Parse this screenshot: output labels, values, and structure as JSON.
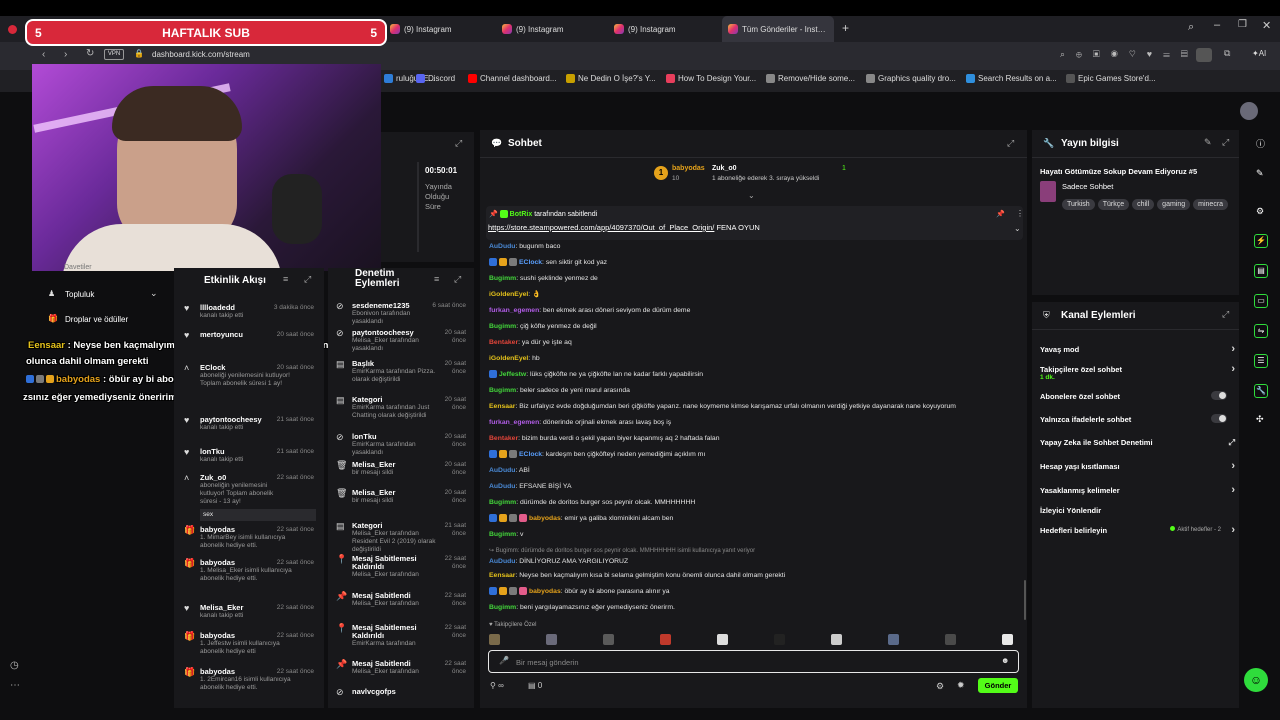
{
  "browser": {
    "tabs": [
      {
        "label": "(9) Instagram",
        "active": false
      },
      {
        "label": "(9) Instagram",
        "active": false
      },
      {
        "label": "(9) Instagram",
        "active": false
      },
      {
        "label": "Tüm Gönderiler - Instagra",
        "active": true
      }
    ],
    "url": "dashboard.kick.com/stream",
    "vpn": "VPN",
    "ai": "AI",
    "bookmarks": [
      {
        "label": "ruluğu (E...",
        "color": "#2e7dd7"
      },
      {
        "label": "Discord",
        "color": "#5865f2"
      },
      {
        "label": "Channel dashboard...",
        "color": "#ff0000"
      },
      {
        "label": "Ne Dedin O İşe?'s Y...",
        "color": "#c8a000"
      },
      {
        "label": "How To Design Your...",
        "color": "#e83e5c"
      },
      {
        "label": "Remove/Hide some...",
        "color": "#888888"
      },
      {
        "label": "Graphics quality dro...",
        "color": "#888888"
      },
      {
        "label": "Search Results on a...",
        "color": "#2f8fdd"
      },
      {
        "label": "Epic Games Store'd...",
        "color": "#555555"
      }
    ]
  },
  "sub_banner": {
    "left_num": "5",
    "title": "HAFTALIK SUB",
    "right_num": "5"
  },
  "overlay_chat": [
    {
      "user": "Eensaar",
      "text": " : Neyse ben kaçmalıyım kısa bi selama gelmiştim konu önemli"
    },
    {
      "user": "",
      "text": "olunca dahil olmam gerekti"
    },
    {
      "user": "babyodas",
      "text": " : öbür ay bi abone parasına alınır ya"
    },
    {
      "user": "",
      "text": "zsınız eğer yemediyseniz öneririm."
    }
  ],
  "stream_stats": {
    "time": "00:50:01",
    "label": "Yayında Olduğu Süre"
  },
  "left_nav": {
    "partial": "Davetiler",
    "items": [
      {
        "label": "Topluluk",
        "expandable": true
      },
      {
        "label": "Droplar ve ödüller",
        "expandable": false
      }
    ]
  },
  "activity_feed": {
    "title": "Etkinlik Akışı",
    "items": [
      {
        "name": "lllloadedd",
        "sub": "kanalı takip etti",
        "time": "3 dakika önce",
        "icon": "heart"
      },
      {
        "name": "mertoyuncu",
        "sub": "",
        "time": "20 saat önce",
        "icon": "heart"
      },
      {
        "name": "EClock",
        "sub": "aboneliği yenilemesini kutluyor! Toplam abonelik süresi 1 ay!",
        "time": "20 saat önce",
        "icon": "caret"
      },
      {
        "name": "paytontoocheesy",
        "sub": "kanalı takip etti",
        "time": "21 saat önce",
        "icon": "heart"
      },
      {
        "name": "lonTku",
        "sub": "kanalı takip etti",
        "time": "21 saat önce",
        "icon": "heart"
      },
      {
        "name": "Zuk_o0",
        "sub": "aboneliğin yenilemesini kutluyor! Toplam abonelik süresi - 13 ay!",
        "time": "22 saat önce",
        "icon": "caret",
        "extra": "sex"
      },
      {
        "name": "babyodas",
        "sub": "1. MimarBey isimli kullanıcıya abonelik hediye etti.",
        "time": "22 saat önce",
        "icon": "gift"
      },
      {
        "name": "babyodas",
        "sub": "1. Melisa_Eker isimli kullanıcıya abonelik hediye etti.",
        "time": "22 saat önce",
        "icon": "gift"
      },
      {
        "name": "Melisa_Eker",
        "sub": "kanalı takip etti",
        "time": "22 saat önce",
        "icon": "heart"
      },
      {
        "name": "babyodas",
        "sub": "1. Jeffestw isimli kullanıcıya abonelik hediye etti",
        "time": "22 saat önce",
        "icon": "gift"
      },
      {
        "name": "babyodas",
        "sub": "1. 2Emircan16 isimli kullanıcıya abonelik hediye etti.",
        "time": "22 saat önce",
        "icon": "gift"
      }
    ]
  },
  "mod_actions": {
    "title": "Denetim Eylemleri",
    "items": [
      {
        "name": "sesdeneme1235",
        "sub": "Ebonivon tarafından yasaklandı",
        "time": "6 saat önce",
        "icon": "ban"
      },
      {
        "name": "paytontoocheesy",
        "sub": "Melisa_Eker tarafından yasaklandı",
        "time": "20 saat önce",
        "icon": "ban"
      },
      {
        "name": "Başlık",
        "sub": "EmirKarma tarafından Pizza. olarak değiştirildi",
        "time": "20 saat önce",
        "icon": "doc"
      },
      {
        "name": "Kategori",
        "sub": "EmirKarma tarafından Just Chatting olarak değiştirildi",
        "time": "20 saat önce",
        "icon": "doc"
      },
      {
        "name": "lonTku",
        "sub": "EmirKarma tarafından yasaklandı",
        "time": "20 saat önce",
        "icon": "ban"
      },
      {
        "name": "Melisa_Eker",
        "sub": "bir mesajı sildi",
        "time": "20 saat önce",
        "icon": "trash"
      },
      {
        "name": "Melisa_Eker",
        "sub": "bir mesajı sildi",
        "time": "20 saat önce",
        "icon": "trash"
      },
      {
        "name": "Kategori",
        "sub": "Melisa_Eker tarafından Resident Evil 2 (2019) olarak değiştirildi",
        "time": "21 saat önce",
        "icon": "doc"
      },
      {
        "name": "Mesaj Sabitlemesi Kaldırıldı",
        "sub": "Melisa_Eker tarafından",
        "time": "22 saat önce",
        "icon": "unpin"
      },
      {
        "name": "Mesaj Sabitlendi",
        "sub": "Melisa_Eker tarafından",
        "time": "22 saat önce",
        "icon": "pin"
      },
      {
        "name": "Mesaj Sabitlemesi Kaldırıldı",
        "sub": "EmirKarma tarafından",
        "time": "22 saat önce",
        "icon": "unpin"
      },
      {
        "name": "Mesaj Sabitlendi",
        "sub": "Melisa_Eker tarafından",
        "time": "22 saat önce",
        "icon": "pin"
      },
      {
        "name": "navlvcgofps",
        "sub": "",
        "time": "",
        "icon": "ban"
      }
    ]
  },
  "chat": {
    "title": "Sohbet",
    "top_gifters": [
      {
        "name": "babyodas",
        "count": "10"
      },
      {
        "name": "Zuk_o0",
        "count": "1 aboneliğe ederek 3. sıraya yükseldi"
      }
    ],
    "gifter_badge_count": "1",
    "pinned": {
      "by_user": "BotRix",
      "by_text": "tarafından sabitlendi",
      "link": "https://store.steampowered.com/app/4097370/Out_of_Place_Origin/",
      "suffix": " FENA OYUN"
    },
    "messages": [
      {
        "user": "AuDudu",
        "color": "#4a8ad6",
        "text": "bugunm baco",
        "badges": []
      },
      {
        "user": "EClock",
        "color": "#5aa0ff",
        "text": "sen siktir git kod yaz",
        "badges": [
          "#2f6fd8",
          "#e5a21b",
          "#7a7a7a"
        ]
      },
      {
        "user": "Bugimm",
        "color": "#43d63b",
        "text": "sushi şeklinde yenmez de",
        "badges": []
      },
      {
        "user": "iGoldenEyel",
        "color": "#e5c21b",
        "text": "👌",
        "badges": []
      },
      {
        "user": "furkan_egemen",
        "color": "#b05ce6",
        "text": "ben ekmek arası döneri seviyom de dürüm deme",
        "badges": []
      },
      {
        "user": "Bugimm",
        "color": "#43d63b",
        "text": "çiğ köfte yenmez de değil",
        "badges": []
      },
      {
        "user": "Bentaker",
        "color": "#e3453a",
        "text": "ya dür ye işte aq",
        "badges": []
      },
      {
        "user": "iGoldenEyel",
        "color": "#e5c21b",
        "text": "hb",
        "badges": []
      },
      {
        "user": "Jeffestw",
        "color": "#43d63b",
        "text": "lüks çiğköfte ne ya çiğköfte lan ne kadar farklı yapabilirsin",
        "badges": [
          "#2f6fd8"
        ]
      },
      {
        "user": "Bugimm",
        "color": "#43d63b",
        "text": "beler sadece de yeni marul arasında",
        "badges": []
      },
      {
        "user": "Eensaar",
        "color": "#e5c21b",
        "text": "Biz urfalıyız evde doğduğumdan beri çiğköfte yaparız. nane koymeme kimse karışamaz urfalı olmanın verdiği yetkiye dayanarak nane koyuyorum",
        "badges": []
      },
      {
        "user": "furkan_egemen",
        "color": "#b05ce6",
        "text": "dönerinde orjinali ekmek arası lavaş boş iş",
        "badges": []
      },
      {
        "user": "Bentaker",
        "color": "#e3453a",
        "text": "bizim burda verdi o şekil yapan biyer kapanmış aq 2 haftada falan",
        "badges": []
      },
      {
        "user": "EClock",
        "color": "#5aa0ff",
        "text": "kardeşm ben çiğköfteyi neden yemediğimi açıklım mı",
        "badges": [
          "#2f6fd8",
          "#e5a21b",
          "#7a7a7a"
        ]
      },
      {
        "user": "AuDudu",
        "color": "#4a8ad6",
        "text": "ABİ",
        "badges": []
      },
      {
        "user": "AuDudu",
        "color": "#4a8ad6",
        "text": "EFSANE BİŞİ YA",
        "badges": []
      },
      {
        "user": "Bugimm",
        "color": "#43d63b",
        "text": "dürümde de doritos burger sos peynir olcak. MMHHHHHH",
        "badges": []
      },
      {
        "user": "babyodas",
        "color": "#e5a21b",
        "text": "emir ya galiba xlominikini alcam ben",
        "badges": [
          "#2f6fd8",
          "#e5a21b",
          "#7a7a7a",
          "#e35c8a"
        ]
      },
      {
        "user": "Bugimm",
        "color": "#43d63b",
        "text": "v",
        "badges": []
      },
      {
        "user": "AuDudu",
        "color": "#4a8ad6",
        "text": "DİNLİYORUZ AMA YARGILIYORUZ",
        "badges": [],
        "reply": "↪ Bugimm: dürümde de doritos burger sos peynir olcak. MMHHHHHH isimli kullanıcıya yanıt veriyor"
      },
      {
        "user": "Eensaar",
        "color": "#e5c21b",
        "text": "Neyse ben kaçmalıyım kısa bi selama gelmiştim konu önemli olunca dahil olmam gerekti",
        "badges": []
      },
      {
        "user": "babyodas",
        "color": "#e5a21b",
        "text": "öbür ay bi abone parasına alınır ya",
        "badges": [
          "#2f6fd8",
          "#e5a21b",
          "#7a7a7a",
          "#e35c8a"
        ]
      },
      {
        "user": "Bugimm",
        "color": "#43d63b",
        "text": "beni yargılayamazsınız eğer yemediyseniz önerirm.",
        "badges": []
      }
    ],
    "emote_section": "Takipçilere Özel",
    "input_placeholder": "Bir mesaj gönderin",
    "points": "0",
    "send_label": "Gönder"
  },
  "stream_info": {
    "title": "Yayın bilgisi",
    "stream_title": "Hayatı Götümüze Sokup Devam Ediyoruz #5",
    "category": "Sadece Sohbet",
    "tags": [
      "Turkish",
      "Türkçe",
      "chill",
      "gaming",
      "minecra"
    ]
  },
  "channel_actions": {
    "title": "Kanal Eylemleri",
    "rows": [
      {
        "label": "Yavaş mod",
        "sub": "",
        "control": "chevron"
      },
      {
        "label": "Takipçilere özel sohbet",
        "sub": "1 dk.",
        "control": "chevron"
      },
      {
        "label": "Abonelere özel sohbet",
        "sub": "",
        "control": "toggle"
      },
      {
        "label": "Yalnızca ifadelerle sohbet",
        "sub": "",
        "control": "toggle"
      },
      {
        "label": "Yapay Zeka ile Sohbet Denetimi",
        "sub": "",
        "control": "external"
      },
      {
        "label": "Hesap yaşı kısıtlaması",
        "sub": "",
        "control": "chevron"
      },
      {
        "label": "Yasaklanmış kelimeler",
        "sub": "",
        "control": "chevron"
      },
      {
        "label": "İzleyici Yönlendir",
        "sub": "",
        "control": "none"
      },
      {
        "label": "Hedefleri belirleyin",
        "sub": "Aktif hedefler - 2",
        "control": "chevron"
      }
    ]
  },
  "colors": {
    "kick_green": "#53fc18",
    "brand_red": "#d8283a",
    "panel": "#18181b"
  }
}
